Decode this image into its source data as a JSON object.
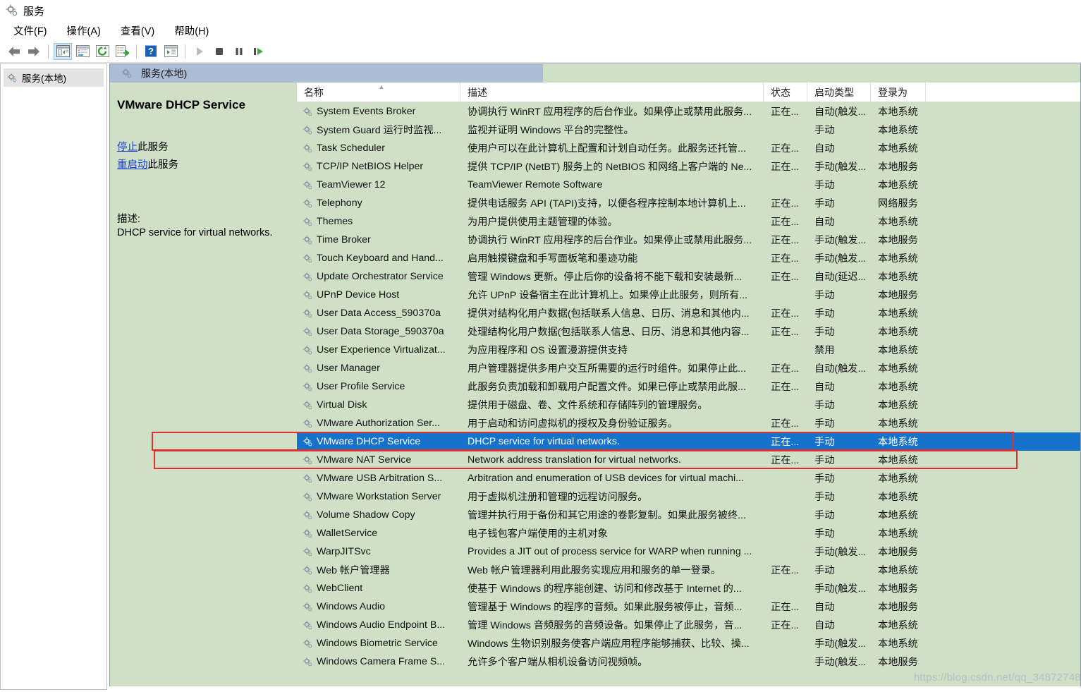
{
  "window": {
    "title": "服务",
    "icon": "services-gear-icon"
  },
  "menu": {
    "items": [
      {
        "label": "文件(F)",
        "name": "menu-file"
      },
      {
        "label": "操作(A)",
        "name": "menu-action"
      },
      {
        "label": "查看(V)",
        "name": "menu-view"
      },
      {
        "label": "帮助(H)",
        "name": "menu-help"
      }
    ]
  },
  "toolbar": {
    "buttons": [
      {
        "name": "back-arrow-icon",
        "icon": "arrow-left"
      },
      {
        "name": "forward-arrow-icon",
        "icon": "arrow-right"
      },
      {
        "name": "show-hide-tree-icon",
        "icon": "panel-toggle",
        "active": true
      },
      {
        "name": "properties-icon",
        "icon": "properties"
      },
      {
        "name": "refresh-icon",
        "icon": "refresh"
      },
      {
        "name": "export-list-icon",
        "icon": "export"
      },
      {
        "name": "help-icon",
        "icon": "help"
      },
      {
        "name": "show-action-pane-icon",
        "icon": "action-pane"
      },
      {
        "name": "start-service-icon",
        "icon": "play"
      },
      {
        "name": "stop-service-icon",
        "icon": "stop"
      },
      {
        "name": "pause-service-icon",
        "icon": "pause"
      },
      {
        "name": "restart-service-icon",
        "icon": "restart"
      }
    ]
  },
  "tree": {
    "items": [
      {
        "label": "服务(本地)",
        "name": "tree-item-services-local"
      }
    ]
  },
  "pane": {
    "header_title": "服务(本地)"
  },
  "details": {
    "service_title": "VMware DHCP Service",
    "stop_link": "停止",
    "stop_suffix": "此服务",
    "restart_link": "重启动",
    "restart_suffix": "此服务",
    "description_label": "描述:",
    "description_text": "DHCP service for virtual networks."
  },
  "list": {
    "columns": [
      {
        "key": "name",
        "label": "名称",
        "sorted": true
      },
      {
        "key": "description",
        "label": "描述"
      },
      {
        "key": "status",
        "label": "状态"
      },
      {
        "key": "startup",
        "label": "启动类型"
      },
      {
        "key": "logon",
        "label": "登录为"
      }
    ],
    "rows": [
      {
        "name": "System Events Broker",
        "description": "协调执行 WinRT 应用程序的后台作业。如果停止或禁用此服务...",
        "status": "正在...",
        "startup": "自动(触发...",
        "logon": "本地系统",
        "selected": false
      },
      {
        "name": "System Guard 运行时监视...",
        "description": "监视并证明 Windows 平台的完整性。",
        "status": "",
        "startup": "手动",
        "logon": "本地系统",
        "selected": false
      },
      {
        "name": "Task Scheduler",
        "description": "使用户可以在此计算机上配置和计划自动任务。此服务还托管...",
        "status": "正在...",
        "startup": "自动",
        "logon": "本地系统",
        "selected": false
      },
      {
        "name": "TCP/IP NetBIOS Helper",
        "description": "提供 TCP/IP (NetBT) 服务上的 NetBIOS 和网络上客户端的 Ne...",
        "status": "正在...",
        "startup": "手动(触发...",
        "logon": "本地服务",
        "selected": false
      },
      {
        "name": "TeamViewer 12",
        "description": "TeamViewer Remote Software",
        "status": "",
        "startup": "手动",
        "logon": "本地系统",
        "selected": false
      },
      {
        "name": "Telephony",
        "description": "提供电话服务 API (TAPI)支持，以便各程序控制本地计算机上...",
        "status": "正在...",
        "startup": "手动",
        "logon": "网络服务",
        "selected": false
      },
      {
        "name": "Themes",
        "description": "为用户提供使用主题管理的体验。",
        "status": "正在...",
        "startup": "自动",
        "logon": "本地系统",
        "selected": false
      },
      {
        "name": "Time Broker",
        "description": "协调执行 WinRT 应用程序的后台作业。如果停止或禁用此服务...",
        "status": "正在...",
        "startup": "手动(触发...",
        "logon": "本地服务",
        "selected": false
      },
      {
        "name": "Touch Keyboard and Hand...",
        "description": "启用触摸键盘和手写面板笔和墨迹功能",
        "status": "正在...",
        "startup": "手动(触发...",
        "logon": "本地系统",
        "selected": false
      },
      {
        "name": "Update Orchestrator Service",
        "description": "管理 Windows 更新。停止后你的设备将不能下载和安装最新...",
        "status": "正在...",
        "startup": "自动(延迟...",
        "logon": "本地系统",
        "selected": false
      },
      {
        "name": "UPnP Device Host",
        "description": "允许 UPnP 设备宿主在此计算机上。如果停止此服务，则所有...",
        "status": "",
        "startup": "手动",
        "logon": "本地服务",
        "selected": false
      },
      {
        "name": "User Data Access_590370a",
        "description": "提供对结构化用户数据(包括联系人信息、日历、消息和其他内...",
        "status": "正在...",
        "startup": "手动",
        "logon": "本地系统",
        "selected": false
      },
      {
        "name": "User Data Storage_590370a",
        "description": "处理结构化用户数据(包括联系人信息、日历、消息和其他内容...",
        "status": "正在...",
        "startup": "手动",
        "logon": "本地系统",
        "selected": false
      },
      {
        "name": "User Experience Virtualizat...",
        "description": "为应用程序和 OS 设置漫游提供支持",
        "status": "",
        "startup": "禁用",
        "logon": "本地系统",
        "selected": false
      },
      {
        "name": "User Manager",
        "description": "用户管理器提供多用户交互所需要的运行时组件。如果停止此...",
        "status": "正在...",
        "startup": "自动(触发...",
        "logon": "本地系统",
        "selected": false
      },
      {
        "name": "User Profile Service",
        "description": "此服务负责加载和卸载用户配置文件。如果已停止或禁用此服...",
        "status": "正在...",
        "startup": "自动",
        "logon": "本地系统",
        "selected": false
      },
      {
        "name": "Virtual Disk",
        "description": "提供用于磁盘、卷、文件系统和存储阵列的管理服务。",
        "status": "",
        "startup": "手动",
        "logon": "本地系统",
        "selected": false
      },
      {
        "name": "VMware Authorization Ser...",
        "description": "用于启动和访问虚拟机的授权及身份验证服务。",
        "status": "正在...",
        "startup": "手动",
        "logon": "本地系统",
        "selected": false
      },
      {
        "name": "VMware DHCP Service",
        "description": "DHCP service for virtual networks.",
        "status": "正在...",
        "startup": "手动",
        "logon": "本地系统",
        "selected": true
      },
      {
        "name": "VMware NAT Service",
        "description": "Network address translation for virtual networks.",
        "status": "正在...",
        "startup": "手动",
        "logon": "本地系统",
        "selected": false
      },
      {
        "name": "VMware USB Arbitration S...",
        "description": "Arbitration and enumeration of USB devices for virtual machi...",
        "status": "",
        "startup": "手动",
        "logon": "本地系统",
        "selected": false
      },
      {
        "name": "VMware Workstation Server",
        "description": "用于虚拟机注册和管理的远程访问服务。",
        "status": "",
        "startup": "手动",
        "logon": "本地系统",
        "selected": false
      },
      {
        "name": "Volume Shadow Copy",
        "description": "管理并执行用于备份和其它用途的卷影复制。如果此服务被终...",
        "status": "",
        "startup": "手动",
        "logon": "本地系统",
        "selected": false
      },
      {
        "name": "WalletService",
        "description": "电子钱包客户端使用的主机对象",
        "status": "",
        "startup": "手动",
        "logon": "本地系统",
        "selected": false
      },
      {
        "name": "WarpJITSvc",
        "description": "Provides a JIT out of process service for WARP when running ...",
        "status": "",
        "startup": "手动(触发...",
        "logon": "本地服务",
        "selected": false
      },
      {
        "name": "Web 帐户管理器",
        "description": "Web 帐户管理器利用此服务实现应用和服务的单一登录。",
        "status": "正在...",
        "startup": "手动",
        "logon": "本地系统",
        "selected": false
      },
      {
        "name": "WebClient",
        "description": "使基于 Windows 的程序能创建、访问和修改基于 Internet 的...",
        "status": "",
        "startup": "手动(触发...",
        "logon": "本地服务",
        "selected": false
      },
      {
        "name": "Windows Audio",
        "description": "管理基于 Windows 的程序的音频。如果此服务被停止，音频...",
        "status": "正在...",
        "startup": "自动",
        "logon": "本地服务",
        "selected": false
      },
      {
        "name": "Windows Audio Endpoint B...",
        "description": "管理 Windows 音频服务的音频设备。如果停止了此服务，音...",
        "status": "正在...",
        "startup": "自动",
        "logon": "本地系统",
        "selected": false
      },
      {
        "name": "Windows Biometric Service",
        "description": "Windows 生物识别服务使客户端应用程序能够捕获、比较、操...",
        "status": "",
        "startup": "手动(触发...",
        "logon": "本地系统",
        "selected": false
      },
      {
        "name": "Windows Camera Frame S...",
        "description": "允许多个客户端从相机设备访问视频帧。",
        "status": "",
        "startup": "手动(触发...",
        "logon": "本地服务",
        "selected": false
      }
    ]
  },
  "annotations": [
    {
      "name": "annotation-box-dhcp",
      "target": "VMware DHCP Service",
      "color": "#e03030"
    },
    {
      "name": "annotation-box-nat",
      "target": "VMware NAT Service",
      "color": "#e03030"
    }
  ],
  "watermark": {
    "text": "https://blog.csdn.net/qq_34872748"
  },
  "colors": {
    "pane_background": "#cfe0c6",
    "selection": "#1573cc",
    "header_band": "#aabdd4",
    "link": "#1a3fcf",
    "annotation": "#e03030"
  }
}
